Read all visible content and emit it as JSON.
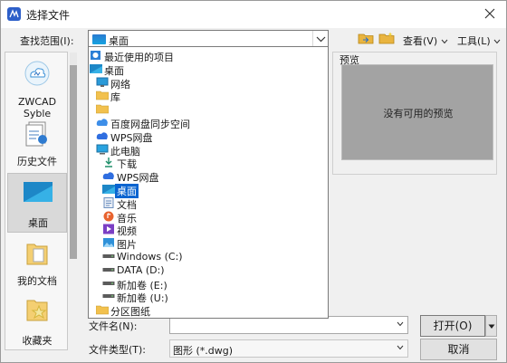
{
  "window": {
    "title": "选择文件",
    "close_icon": "close-icon"
  },
  "toolbar": {
    "look_in_label": "查找范围(I):",
    "look_in_value": "桌面",
    "view_menu": "查看(V)",
    "tools_menu": "工具(L)"
  },
  "places": [
    {
      "label": "ZWCAD Syble",
      "icon": "zwcad-cloud-icon"
    },
    {
      "label": "历史文件",
      "icon": "history-icon"
    },
    {
      "label": "桌面",
      "icon": "desktop-icon",
      "selected": true
    },
    {
      "label": "我的文档",
      "icon": "documents-icon"
    },
    {
      "label": "收藏夹",
      "icon": "favorites-icon"
    }
  ],
  "dropdown_items": [
    {
      "label": "最近使用的项目",
      "icon": "recent-icon",
      "indent": 0
    },
    {
      "label": "桌面",
      "icon": "desktop-icon",
      "indent": 0
    },
    {
      "label": "网络",
      "icon": "network-icon",
      "indent": 1
    },
    {
      "label": "库",
      "icon": "library-icon",
      "indent": 1
    },
    {
      "label": "",
      "icon": "folder-icon",
      "indent": 1
    },
    {
      "label": "百度网盘同步空间",
      "icon": "baidu-cloud-icon",
      "indent": 1
    },
    {
      "label": "WPS网盘",
      "icon": "wps-cloud-icon",
      "indent": 1
    },
    {
      "label": "此电脑",
      "icon": "computer-icon",
      "indent": 1
    },
    {
      "label": "下载",
      "icon": "download-icon",
      "indent": 2
    },
    {
      "label": "WPS网盘",
      "icon": "wps-cloud-icon",
      "indent": 2
    },
    {
      "label": "桌面",
      "icon": "desktop-icon",
      "indent": 2,
      "selected": true
    },
    {
      "label": "文档",
      "icon": "document-icon",
      "indent": 2
    },
    {
      "label": "音乐",
      "icon": "music-icon",
      "indent": 2
    },
    {
      "label": "视频",
      "icon": "video-icon",
      "indent": 2
    },
    {
      "label": "图片",
      "icon": "pictures-icon",
      "indent": 2
    },
    {
      "label": "Windows (C:)",
      "icon": "drive-icon",
      "indent": 2
    },
    {
      "label": "DATA (D:)",
      "icon": "drive-icon",
      "indent": 2
    },
    {
      "label": "新加卷 (E:)",
      "icon": "drive-icon",
      "indent": 2
    },
    {
      "label": "新加卷 (U:)",
      "icon": "drive-icon",
      "indent": 2
    },
    {
      "label": "分区图纸",
      "icon": "folder-icon",
      "indent": 1
    }
  ],
  "preview": {
    "label": "预览",
    "empty_text": "没有可用的预览"
  },
  "file_name": {
    "label": "文件名(N):",
    "value": ""
  },
  "file_type": {
    "label": "文件类型(T):",
    "value": "图形 (*.dwg)"
  },
  "buttons": {
    "open": "打开(O)",
    "cancel": "取消"
  },
  "colors": {
    "selection": "#0a64d0",
    "preview_bg": "#a3a3a3",
    "folder": "#f2c14e"
  }
}
